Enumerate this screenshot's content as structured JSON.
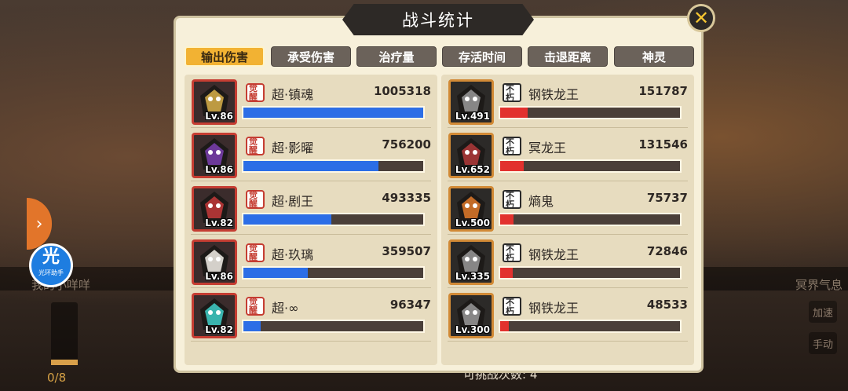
{
  "background": {
    "left_label": "我的小咩咩",
    "right_label": "冥界气息",
    "btn_auto": "加速",
    "btn_manual": "手动",
    "energy": "0/8",
    "bottom_info": "可挑战次数: 4",
    "assist_big": "光",
    "assist_small": "光环助手"
  },
  "modal": {
    "title": "战斗统计",
    "close_icon": "close-x-icon",
    "tabs": [
      {
        "label": "输出伤害",
        "active": true
      },
      {
        "label": "承受伤害",
        "active": false
      },
      {
        "label": "治疗量",
        "active": false
      },
      {
        "label": "存活时间",
        "active": false
      },
      {
        "label": "击退距离",
        "active": false
      },
      {
        "label": "神灵",
        "active": false
      }
    ],
    "heroes": [
      {
        "name": "超·镇魂",
        "value": "1005318",
        "level": "Lv.86",
        "badge": "觉醒",
        "fraction": 1.0
      },
      {
        "name": "超·影曜",
        "value": "756200",
        "level": "Lv.86",
        "badge": "觉醒",
        "fraction": 0.752
      },
      {
        "name": "超·剧王",
        "value": "493335",
        "level": "Lv.82",
        "badge": "觉醒",
        "fraction": 0.491
      },
      {
        "name": "超·玖璃",
        "value": "359507",
        "level": "Lv.86",
        "badge": "觉醒",
        "fraction": 0.358
      },
      {
        "name": "超·∞",
        "value": "96347",
        "level": "Lv.82",
        "badge": "觉醒",
        "fraction": 0.096
      }
    ],
    "enemies": [
      {
        "name": "钢铁龙王",
        "value": "151787",
        "level": "Lv.491",
        "badge": "不朽",
        "fraction": 0.151
      },
      {
        "name": "冥龙王",
        "value": "131546",
        "level": "Lv.652",
        "badge": "不朽",
        "fraction": 0.131
      },
      {
        "name": "熵鬼",
        "value": "75737",
        "level": "Lv.500",
        "badge": "不朽",
        "fraction": 0.075
      },
      {
        "name": "钢铁龙王",
        "value": "72846",
        "level": "Lv.335",
        "badge": "不朽",
        "fraction": 0.072
      },
      {
        "name": "钢铁龙王",
        "value": "48533",
        "level": "Lv.300",
        "badge": "不朽",
        "fraction": 0.048
      }
    ]
  }
}
